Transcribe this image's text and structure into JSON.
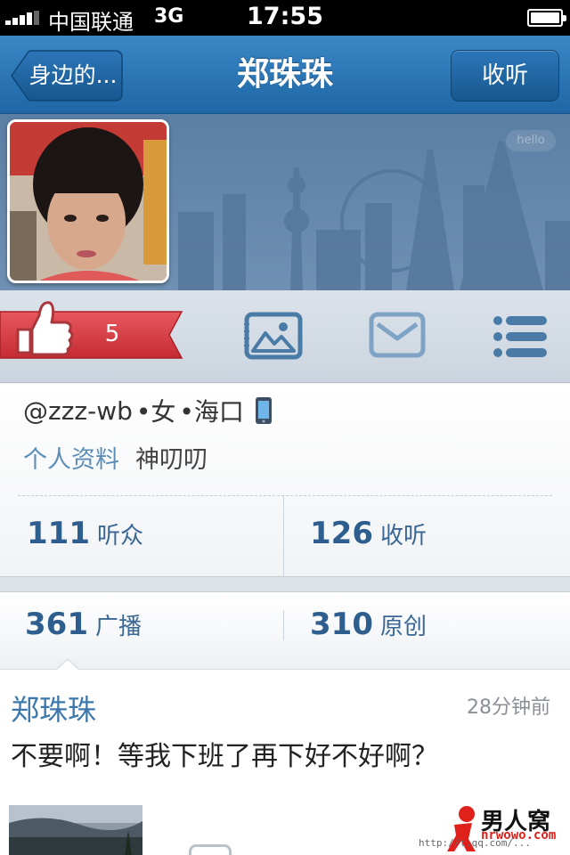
{
  "status_bar": {
    "carrier": "中国联通",
    "network": "3G",
    "time": "17:55"
  },
  "nav": {
    "back_label": "身边的...",
    "title": "郑珠珠",
    "right_button": "收听"
  },
  "cover": {
    "tag": "hello"
  },
  "actions": {
    "like_count": "5",
    "icons": [
      "thumbs-up-icon",
      "photo-icon",
      "mail-icon",
      "list-icon"
    ]
  },
  "profile": {
    "handle": "@zzz-wb",
    "gender": "•女",
    "location": "•海口",
    "profile_link": "个人资料",
    "nickname": "神叨叨"
  },
  "stats": {
    "listeners_count": "111",
    "listeners_label": "听众",
    "following_count": "126",
    "following_label": "收听",
    "broadcasts_count": "361",
    "broadcasts_label": "广播",
    "original_count": "310",
    "original_label": "原创"
  },
  "tweet": {
    "author": "郑珠珠",
    "time": "28分钟前",
    "text": "不要啊！等我下班了再下好不好啊？"
  },
  "watermark": {
    "logo": "男人窝",
    "site": "nrwowo.com",
    "url": "http://t.qq.com/..."
  },
  "colors": {
    "nav_blue": "#2a74b5",
    "link_blue": "#5b8db8",
    "stat_blue": "#2e5e8e",
    "ribbon_red": "#d9363e"
  }
}
